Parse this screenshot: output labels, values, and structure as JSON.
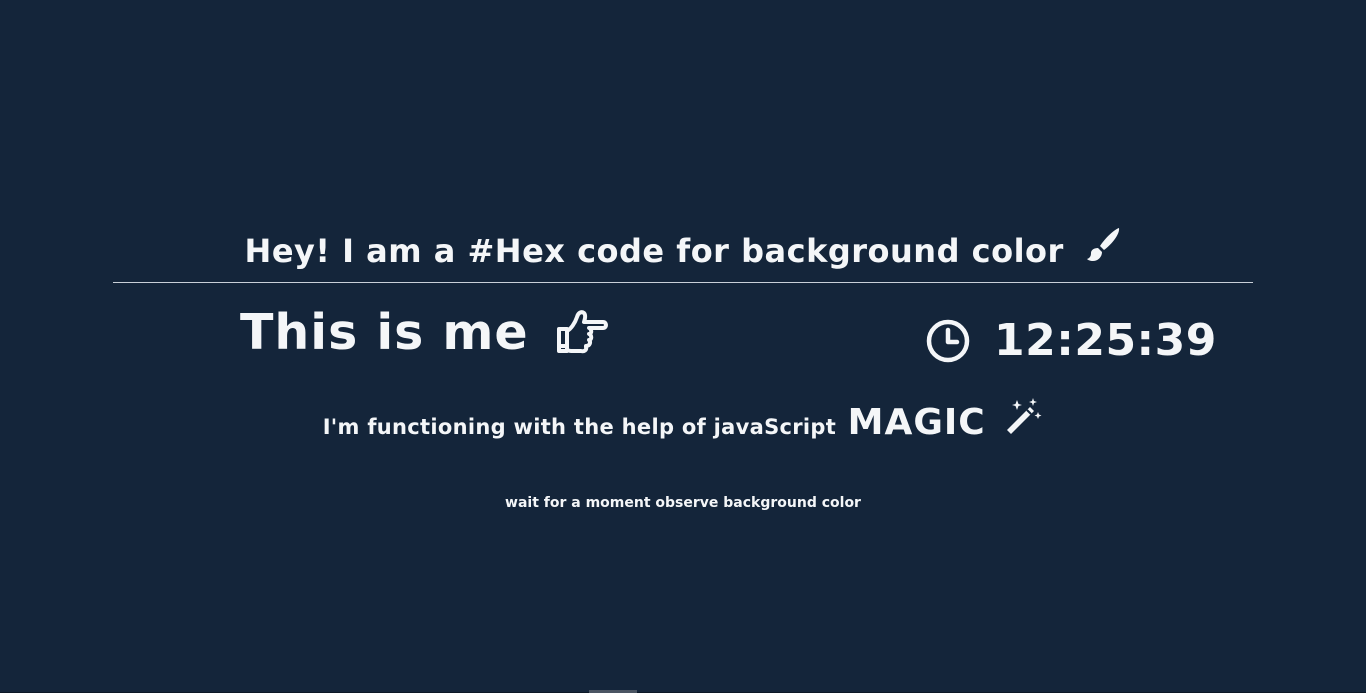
{
  "colors": {
    "background": "#14253a",
    "text": "#f4f6f8",
    "divider": "#c9d0d8"
  },
  "heading": {
    "text": "Hey! I am a #Hex code for background color",
    "icon": "paintbrush-icon"
  },
  "identity": {
    "label": "This is me",
    "icon": "hand-pointing-right-icon"
  },
  "clock": {
    "icon": "clock-icon",
    "time": "12:25:39"
  },
  "subline": {
    "text": "I'm functioning with the help of javaScript",
    "emphasis": "MAGIC",
    "icon": "magic-wand-icon"
  },
  "hint": {
    "text": "wait for a moment observe background color"
  }
}
